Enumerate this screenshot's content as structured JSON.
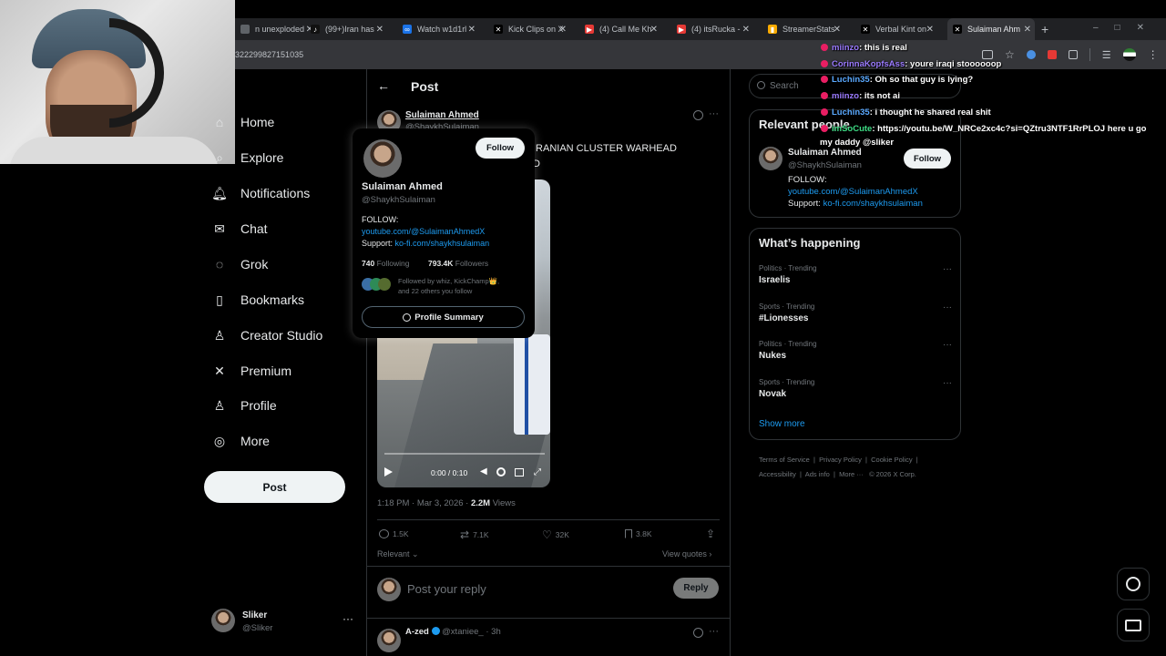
{
  "browser": {
    "tabs": [
      {
        "label": "n unexploded",
        "icon": "globe-icon"
      },
      {
        "label": "(99+)Iran has",
        "icon": "tiktok-icon"
      },
      {
        "label": "Watch w1d1rl",
        "icon": "kick-icon"
      },
      {
        "label": "Kick Clips on X",
        "icon": "x-icon"
      },
      {
        "label": "(4) Call Me Kh",
        "icon": "youtube-icon"
      },
      {
        "label": "(4) itsRucka -",
        "icon": "youtube-icon"
      },
      {
        "label": "StreamerStats",
        "icon": "chart-icon"
      },
      {
        "label": "Verbal Kint on",
        "icon": "x-icon"
      },
      {
        "label": "Sulaiman Ahm",
        "icon": "x-icon"
      }
    ],
    "url": "322299827151035"
  },
  "nav": {
    "items": [
      {
        "label": "Home",
        "icon": "home-icon"
      },
      {
        "label": "Explore",
        "icon": "search-icon"
      },
      {
        "label": "Notifications",
        "icon": "bell-icon"
      },
      {
        "label": "Chat",
        "icon": "mail-icon"
      },
      {
        "label": "Grok",
        "icon": "grok-icon"
      },
      {
        "label": "Bookmarks",
        "icon": "bookmark-icon"
      },
      {
        "label": "Creator Studio",
        "icon": "creator-studio-icon"
      },
      {
        "label": "Premium",
        "icon": "x-icon"
      },
      {
        "label": "Profile",
        "icon": "person-icon"
      },
      {
        "label": "More",
        "icon": "more-circle-icon"
      }
    ],
    "post_label": "Post",
    "account": {
      "name": "Sliker",
      "handle": "@Sliker"
    }
  },
  "post": {
    "header": "Post",
    "author_name": "Sulaiman Ahmed",
    "author_handle": "@ShaykhSulaiman",
    "text_line1": "IRANIAN CLUSTER WARHEAD",
    "text_line2": "D",
    "video_time": "0:00 / 0:10",
    "timestamp": "1:18 PM · Mar 3, 2026 ·",
    "views_count": "2.2M",
    "views_label": "Views",
    "replies": "1.5K",
    "reposts": "7.1K",
    "likes": "32K",
    "bookmarks": "3.8K",
    "sort_label": "Relevant",
    "quotes_label": "View quotes",
    "reply_placeholder": "Post your reply",
    "reply_button": "Reply",
    "next_reply": {
      "name": "A-zed",
      "handle": "@xtaniee_ · 3h"
    }
  },
  "hovercard": {
    "follow_label": "Follow",
    "name": "Sulaiman Ahmed",
    "handle": "@ShaykhSulaiman",
    "bio_follow": "FOLLOW:",
    "bio_link1": "youtube.com/@SulaimanAhmedX",
    "bio_support": "Support:",
    "bio_link2": "ko-fi.com/shaykhsulaiman",
    "following_count": "740",
    "following_label": "Following",
    "followers_count": "793.4K",
    "followers_label": "Followers",
    "followed_by_line1": "Followed by whiz, KickChamp👑,",
    "followed_by_line2": "and 22 others you follow",
    "summary_label": "Profile Summary"
  },
  "sidebar": {
    "search_placeholder": "Search",
    "relevant_title": "Relevant people",
    "person": {
      "name": "Sulaiman Ahmed",
      "handle": "@ShaykhSulaiman",
      "follow_label": "Follow",
      "bio_follow": "FOLLOW:",
      "bio_link1": "youtube.com/@SulaimanAhmedX",
      "bio_support": "Support:",
      "bio_link2": "ko-fi.com/shaykhsulaiman"
    },
    "happening_title": "What’s happening",
    "trends": [
      {
        "context": "Politics · Trending",
        "name": "Israelis"
      },
      {
        "context": "Sports · Trending",
        "name": "#Lionesses"
      },
      {
        "context": "Politics · Trending",
        "name": "Nukes"
      },
      {
        "context": "Sports · Trending",
        "name": "Novak"
      }
    ],
    "show_more": "Show more",
    "footer": {
      "terms": "Terms of Service",
      "privacy": "Privacy Policy",
      "cookie": "Cookie Policy",
      "accessibility": "Accessibility",
      "ads": "Ads info",
      "more": "More ···",
      "copyright": "© 2026 X Corp."
    }
  },
  "chat": [
    {
      "user": "miinzo",
      "color": "#9b7bff",
      "message": ": this is real"
    },
    {
      "user": "CorinnaKopfsAss",
      "color": "#9b7bff",
      "message": ": youre iraqi stoooooop"
    },
    {
      "user": "Luchin35",
      "color": "#5aa9ff",
      "message": ": Oh so that guy is lying?"
    },
    {
      "user": "miinzo",
      "color": "#9b7bff",
      "message": ": its not ai"
    },
    {
      "user": "Luchin35",
      "color": "#5aa9ff",
      "message": ": i thought he shared real shit"
    },
    {
      "user": "imSoCute",
      "color": "#3ddc84",
      "message": ": https://youtu.be/W_NRCe2xc4c?si=QZtru3NTF1RrPLOJ here u go"
    },
    {
      "user": "",
      "color": "#ffffff",
      "message": "my daddy @sliker"
    }
  ]
}
